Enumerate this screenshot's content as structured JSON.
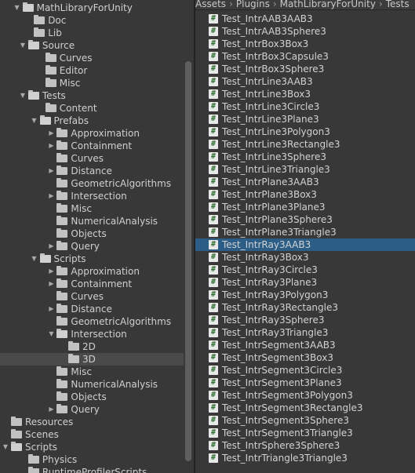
{
  "breadcrumb": [
    "Assets",
    "Plugins",
    "MathLibraryForUnity",
    "Tests"
  ],
  "tree": [
    {
      "label": "MathLibraryForUnity",
      "depth": 1,
      "arrow": "down"
    },
    {
      "label": "Doc",
      "depth": 2,
      "arrow": ""
    },
    {
      "label": "Lib",
      "depth": 2,
      "arrow": ""
    },
    {
      "label": "Source",
      "depth": 1.5,
      "arrow": "down"
    },
    {
      "label": "Curves",
      "depth": 3,
      "arrow": ""
    },
    {
      "label": "Editor",
      "depth": 3,
      "arrow": ""
    },
    {
      "label": "Misc",
      "depth": 3,
      "arrow": ""
    },
    {
      "label": "Tests",
      "depth": 1.5,
      "arrow": "down"
    },
    {
      "label": "Content",
      "depth": 3,
      "arrow": ""
    },
    {
      "label": "Prefabs",
      "depth": 2.5,
      "arrow": "down"
    },
    {
      "label": "Approximation",
      "depth": 4,
      "arrow": "right"
    },
    {
      "label": "Containment",
      "depth": 4,
      "arrow": "right"
    },
    {
      "label": "Curves",
      "depth": 4,
      "arrow": ""
    },
    {
      "label": "Distance",
      "depth": 4,
      "arrow": "right"
    },
    {
      "label": "GeometricAlgorithms",
      "depth": 4,
      "arrow": ""
    },
    {
      "label": "Intersection",
      "depth": 4,
      "arrow": "right"
    },
    {
      "label": "Misc",
      "depth": 4,
      "arrow": ""
    },
    {
      "label": "NumericalAnalysis",
      "depth": 4,
      "arrow": ""
    },
    {
      "label": "Objects",
      "depth": 4,
      "arrow": ""
    },
    {
      "label": "Query",
      "depth": 4,
      "arrow": "right"
    },
    {
      "label": "Scripts",
      "depth": 2.5,
      "arrow": "down"
    },
    {
      "label": "Approximation",
      "depth": 4,
      "arrow": "right"
    },
    {
      "label": "Containment",
      "depth": 4,
      "arrow": "right"
    },
    {
      "label": "Curves",
      "depth": 4,
      "arrow": ""
    },
    {
      "label": "Distance",
      "depth": 4,
      "arrow": "right"
    },
    {
      "label": "GeometricAlgorithms",
      "depth": 4,
      "arrow": ""
    },
    {
      "label": "Intersection",
      "depth": 4,
      "arrow": "down"
    },
    {
      "label": "2D",
      "depth": 5,
      "arrow": ""
    },
    {
      "label": "3D",
      "depth": 5,
      "arrow": "",
      "selected": true
    },
    {
      "label": "Misc",
      "depth": 4,
      "arrow": ""
    },
    {
      "label": "NumericalAnalysis",
      "depth": 4,
      "arrow": ""
    },
    {
      "label": "Objects",
      "depth": 4,
      "arrow": ""
    },
    {
      "label": "Query",
      "depth": 4,
      "arrow": "right"
    },
    {
      "label": "Resources",
      "depth": 0,
      "arrow": ""
    },
    {
      "label": "Scenes",
      "depth": 0,
      "arrow": ""
    },
    {
      "label": "Scripts",
      "depth": 0,
      "arrow": "down"
    },
    {
      "label": "Physics",
      "depth": 1.5,
      "arrow": ""
    },
    {
      "label": "RuntimeProfilerScripts",
      "depth": 1.5,
      "arrow": ""
    }
  ],
  "files": [
    "Test_IntrAAB3AAB3",
    "Test_IntrAAB3Sphere3",
    "Test_IntrBox3Box3",
    "Test_IntrBox3Capsule3",
    "Test_IntrBox3Sphere3",
    "Test_IntrLine3AAB3",
    "Test_IntrLine3Box3",
    "Test_IntrLine3Circle3",
    "Test_IntrLine3Plane3",
    "Test_IntrLine3Polygon3",
    "Test_IntrLine3Rectangle3",
    "Test_IntrLine3Sphere3",
    "Test_IntrLine3Triangle3",
    "Test_IntrPlane3AAB3",
    "Test_IntrPlane3Box3",
    "Test_IntrPlane3Plane3",
    "Test_IntrPlane3Sphere3",
    "Test_IntrPlane3Triangle3",
    "Test_IntrRay3AAB3",
    "Test_IntrRay3Box3",
    "Test_IntrRay3Circle3",
    "Test_IntrRay3Plane3",
    "Test_IntrRay3Polygon3",
    "Test_IntrRay3Rectangle3",
    "Test_IntrRay3Sphere3",
    "Test_IntrRay3Triangle3",
    "Test_IntrSegment3AAB3",
    "Test_IntrSegment3Box3",
    "Test_IntrSegment3Circle3",
    "Test_IntrSegment3Plane3",
    "Test_IntrSegment3Polygon3",
    "Test_IntrSegment3Rectangle3",
    "Test_IntrSegment3Sphere3",
    "Test_IntrSegment3Triangle3",
    "Test_IntrSphere3Sphere3",
    "Test_IntrTriangle3Triangle3"
  ],
  "selected_file": "Test_IntrRay3AAB3",
  "file_icon_glyph": "#",
  "colors": {
    "selection_blue": "#2c5d87",
    "background": "#383838",
    "icon_green": "#2f6b2f"
  }
}
